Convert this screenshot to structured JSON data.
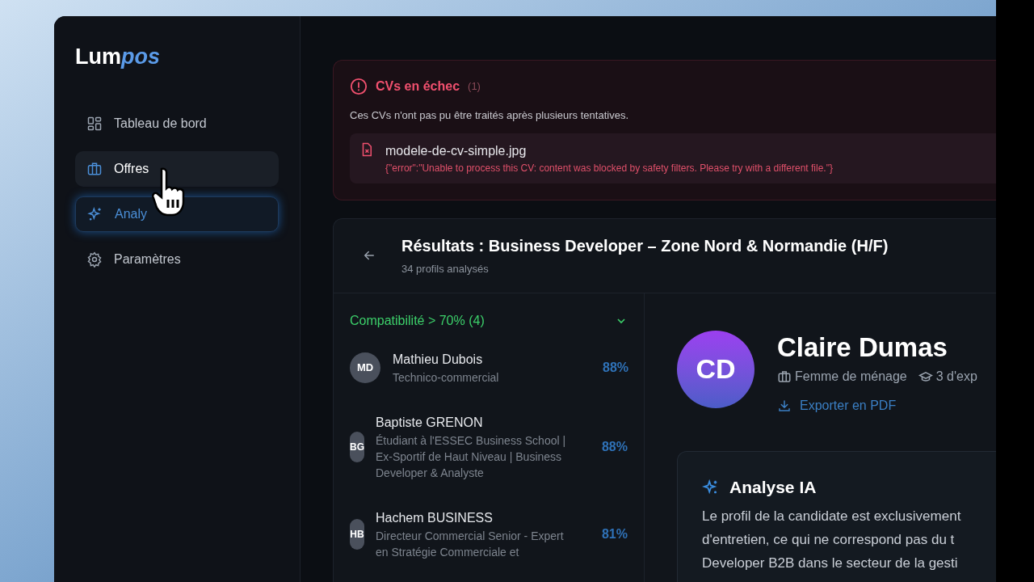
{
  "app": {
    "logo_main": "Lum",
    "logo_accent": "pos"
  },
  "sidebar": {
    "items": [
      {
        "label": "Tableau de bord",
        "selected": false,
        "hovered": false
      },
      {
        "label": "Offres",
        "selected": false,
        "hovered": true
      },
      {
        "label": "Analy",
        "selected": true,
        "hovered": false
      },
      {
        "label": "Paramètres",
        "selected": false,
        "hovered": false
      }
    ]
  },
  "failed_cvs": {
    "title": "CVs en échec",
    "count": "(1)",
    "description": "Ces CVs n'ont pas pu être traités après plusieurs tentatives.",
    "files": [
      {
        "name": "modele-de-cv-simple.jpg",
        "error": "{\"error\":\"Unable to process this CV: content was blocked by safety filters. Please try with a different file.\"}"
      }
    ]
  },
  "results": {
    "title": "Résultats : Business Developer – Zone Nord & Normandie (H/F)",
    "subtitle": "34 profils analysés",
    "group": {
      "label": "Compatibilité > 70% (4)",
      "expanded": true
    },
    "candidates": [
      {
        "initials": "MD",
        "name": "Mathieu Dubois",
        "headline": "Technico-commercial",
        "score": "88%",
        "kind": "round"
      },
      {
        "initials": "BG",
        "name": "Baptiste GRENON",
        "headline": "Étudiant à l'ESSEC Business School | Ex-Sportif de Haut Niveau | Business Developer & Analyste",
        "score": "88%",
        "kind": "squeezed"
      },
      {
        "initials": "HB",
        "name": "Hachem BUSINESS",
        "headline": "Directeur Commercial Senior - Expert en Stratégie Commerciale et",
        "score": "81%",
        "kind": "squeezed"
      }
    ]
  },
  "detail": {
    "initials": "CD",
    "name": "Claire Dumas",
    "job": "Femme de ménage",
    "experience": "3 d'exp",
    "export": "Exporter en PDF",
    "analysis": {
      "title": "Analyse IA",
      "lines": [
        "Le profil de la candidate est exclusivement",
        "d'entretien, ce qui ne correspond pas du t",
        "Developer B2B dans le secteur de la gesti"
      ]
    }
  }
}
